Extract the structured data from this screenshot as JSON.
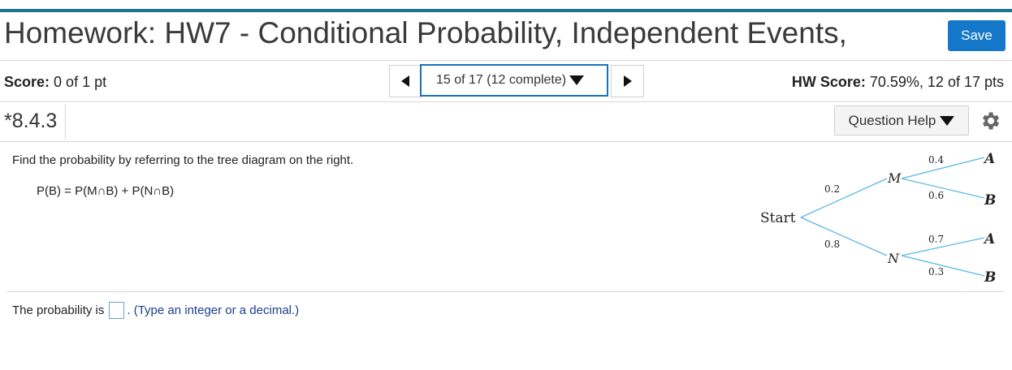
{
  "header": {
    "title": "Homework: HW7 - Conditional Probability, Independent Events,",
    "save_label": "Save"
  },
  "score": {
    "label": "Score:",
    "value": "0 of 1 pt"
  },
  "navigation": {
    "position_label": "15 of 17 (12 complete)"
  },
  "hw_score": {
    "label": "HW Score:",
    "value": "70.59%, 12 of 17 pts"
  },
  "question": {
    "id": "*8.4.3",
    "help_label": "Question Help",
    "instruction": "Find the probability by referring to the tree diagram on the right.",
    "formula": "P(B) = P(M∩B) + P(N∩B)"
  },
  "tree": {
    "start_label": "Start",
    "node_m": "M",
    "node_n": "N",
    "p_m": "0.2",
    "p_n": "0.8",
    "p_a_given_m": "0.4",
    "p_b_given_m": "0.6",
    "p_a_given_n": "0.7",
    "p_b_given_n": "0.3",
    "leaf_a1": "A",
    "leaf_b1": "B",
    "leaf_a2": "A",
    "leaf_b2": "B",
    "line_color": "#5bb8e6"
  },
  "answer": {
    "prefix": "The probability is",
    "input_value": "",
    "hint": ". (Type an integer or a decimal.)"
  },
  "colors": {
    "accent_bar": "#1a7595",
    "save_button": "#1477c9",
    "nav_border": "#1a72b9"
  }
}
